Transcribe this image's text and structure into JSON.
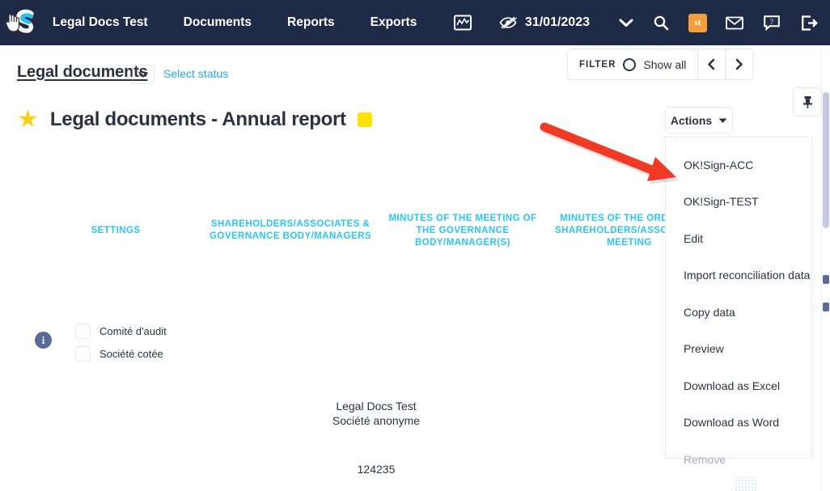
{
  "topnav": {
    "logo": "S",
    "items": [
      {
        "label": "Legal Docs Test"
      },
      {
        "label": "Documents"
      },
      {
        "label": "Reports"
      },
      {
        "label": "Exports"
      }
    ],
    "chart_icon": "chart-icon",
    "eye_icon": "eye-slash-icon",
    "date": "31/01/2023",
    "caret_icon": "chevron-down-icon",
    "right_icons": [
      {
        "name": "search-icon"
      },
      {
        "name": "st-badge",
        "label": "st"
      },
      {
        "name": "mail-icon"
      },
      {
        "name": "help-icon"
      },
      {
        "name": "logout-icon"
      }
    ],
    "bg_color": "#1f2a47"
  },
  "subheader": {
    "breadcrumb": "Legal documents",
    "breadcrumb_caret": "chevron-down-icon",
    "select_status": "Select status",
    "filter": {
      "label": "FILTER",
      "value": "Show all",
      "prev_icon": "chevron-left-icon",
      "next_icon": "chevron-right-icon"
    }
  },
  "title": {
    "star_icon": "star-icon",
    "text": "Legal documents - Annual report",
    "chip_color": "#ffe300"
  },
  "columns": [
    {
      "id": "settings",
      "label": "SETTINGS"
    },
    {
      "id": "shareholders",
      "label": "SHAREHOLDERS/ASSOCIATES & GOVERNANCE BODY/MANAGERS"
    },
    {
      "id": "minutes_governance",
      "label": "MINUTES OF THE MEETING OF THE GOVERNANCE BODY/MANAGER(S)"
    },
    {
      "id": "minutes_ordinary",
      "label": "MINUTES OF THE ORDINARY SHAREHOLDERS/ASSOCIATES MEETING"
    }
  ],
  "column_accent": "#29c6f5",
  "left_panel": {
    "info_icon": "info-icon",
    "info_letter": "i",
    "checkboxes": [
      {
        "label": "Comité d'audit",
        "checked": false
      },
      {
        "label": "Société cotée",
        "checked": false
      }
    ]
  },
  "center": {
    "company_name": "Legal Docs Test",
    "company_form": "Société anonyme",
    "number": "124235"
  },
  "pin_button": {
    "icon": "pin-icon"
  },
  "actions": {
    "button_label": "Actions",
    "caret_icon": "chevron-down-icon",
    "menu_items": [
      {
        "label": "OK!Sign-ACC",
        "disabled": false
      },
      {
        "label": "OK!Sign-TEST",
        "disabled": false
      },
      {
        "label": "Edit",
        "disabled": false
      },
      {
        "label": "Import reconciliation data",
        "disabled": false
      },
      {
        "label": "Copy data",
        "disabled": false
      },
      {
        "label": "Preview",
        "disabled": false
      },
      {
        "label": "Download as Excel",
        "disabled": false
      },
      {
        "label": "Download as Word",
        "disabled": false
      },
      {
        "label": "Remove",
        "disabled": true
      }
    ]
  },
  "annotation": {
    "arrow_color": "#f03a26",
    "points_to": "OK!Sign-ACC"
  },
  "cursor": {
    "icon": "hand-pointer-cursor"
  }
}
